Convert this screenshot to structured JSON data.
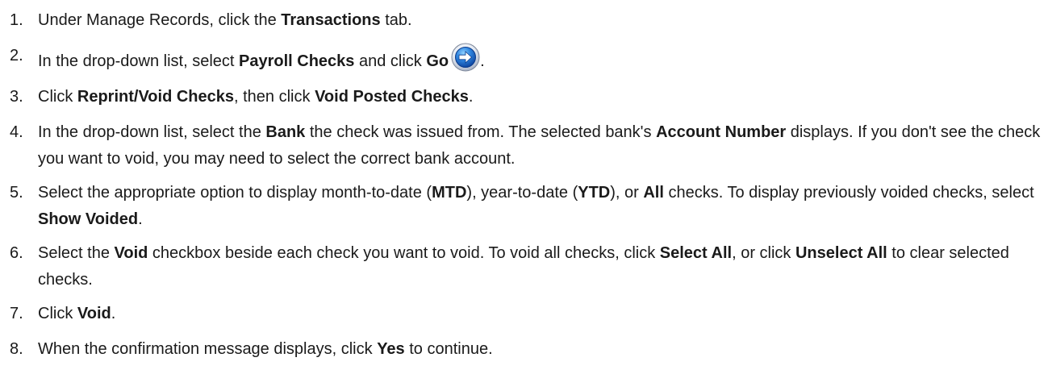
{
  "steps": [
    {
      "num": "1.",
      "parts": [
        {
          "t": "Under Manage Records, click the "
        },
        {
          "t": "Transactions",
          "b": true
        },
        {
          "t": " tab."
        }
      ]
    },
    {
      "num": "2.",
      "parts": [
        {
          "t": "In the drop-down list, select "
        },
        {
          "t": "Payroll Checks",
          "b": true
        },
        {
          "t": " and click "
        },
        {
          "t": "Go",
          "b": true
        },
        {
          "icon": "go-arrow-icon"
        },
        {
          "t": "."
        }
      ]
    },
    {
      "num": "3.",
      "parts": [
        {
          "t": "Click "
        },
        {
          "t": "Reprint/Void Checks",
          "b": true
        },
        {
          "t": ", then click "
        },
        {
          "t": "Void Posted Checks",
          "b": true
        },
        {
          "t": "."
        }
      ]
    },
    {
      "num": "4.",
      "parts": [
        {
          "t": "In the drop-down list, select the "
        },
        {
          "t": "Bank",
          "b": true
        },
        {
          "t": " the check was issued from. The selected bank's "
        },
        {
          "t": "Account Number",
          "b": true
        },
        {
          "t": " displays. If you don't see the check you want to void, you may need to select the correct bank account."
        }
      ]
    },
    {
      "num": "5.",
      "parts": [
        {
          "t": "Select the appropriate option to display month-to-date ("
        },
        {
          "t": "MTD",
          "b": true
        },
        {
          "t": "), year-to-date ("
        },
        {
          "t": "YTD",
          "b": true
        },
        {
          "t": "), or "
        },
        {
          "t": "All",
          "b": true
        },
        {
          "t": " checks. To display previously voided checks, select "
        },
        {
          "t": "Show Voided",
          "b": true
        },
        {
          "t": "."
        }
      ]
    },
    {
      "num": "6.",
      "parts": [
        {
          "t": "Select the "
        },
        {
          "t": "Void",
          "b": true
        },
        {
          "t": " checkbox beside each check you want to void. To void all checks, click "
        },
        {
          "t": "Select All",
          "b": true
        },
        {
          "t": ", or click "
        },
        {
          "t": "Unselect All",
          "b": true
        },
        {
          "t": " to clear selected checks."
        }
      ]
    },
    {
      "num": "7.",
      "parts": [
        {
          "t": "Click "
        },
        {
          "t": "Void",
          "b": true
        },
        {
          "t": "."
        }
      ]
    },
    {
      "num": "8.",
      "parts": [
        {
          "t": "When the confirmation message displays, click "
        },
        {
          "t": "Yes",
          "b": true
        },
        {
          "t": " to continue."
        }
      ]
    }
  ]
}
